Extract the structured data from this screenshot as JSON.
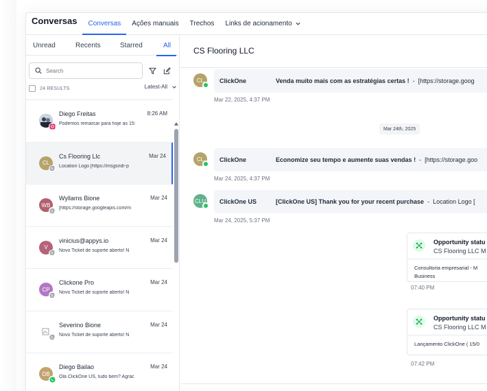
{
  "app": {
    "title": "Conversas"
  },
  "nav": {
    "tabs": [
      {
        "label": "Conversas"
      },
      {
        "label": "Ações manuais"
      },
      {
        "label": "Trechos"
      },
      {
        "label": "Links de acionamento"
      }
    ]
  },
  "filters": {
    "tabs": [
      {
        "label": "Unread"
      },
      {
        "label": "Recents"
      },
      {
        "label": "Starred"
      },
      {
        "label": "All"
      }
    ],
    "active": "All"
  },
  "search": {
    "placeholder": "Search",
    "results": "24 RESULTS",
    "sort": "Latest-All"
  },
  "conversations": [
    {
      "name": "Diego Freitas",
      "time": "8:26 AM",
      "preview": "Podemos remarcar para hoje as 15:",
      "initials": "",
      "channel": "instagram"
    },
    {
      "name": "Cs Flooring Llc",
      "time": "Mar 24",
      "preview": "Location Logo [https://msgsndr-p",
      "initials": "CL",
      "channel": "email"
    },
    {
      "name": "Wyllams Bione",
      "time": "Mar 24",
      "preview": "[https://storage.googleapis.com/m",
      "initials": "WB",
      "channel": "email"
    },
    {
      "name": "vinicius@appys.io",
      "time": "Mar 24",
      "preview": "Novo Ticket de suporte aberto! N",
      "initials": "V",
      "channel": "email"
    },
    {
      "name": "Clickone Pro",
      "time": "Mar 24",
      "preview": "Novo Ticket de suporte aberto! N",
      "initials": "CP",
      "channel": "email"
    },
    {
      "name": "Severino Bione",
      "time": "Mar 24",
      "preview": "Novo Ticket de suporte aberto! N",
      "initials": "",
      "channel": "email"
    },
    {
      "name": "Diego Bailao",
      "time": "Mar 24",
      "preview": "Olá ClickOne US, tudo bem? Agrac",
      "initials": "DB",
      "channel": "whatsapp"
    }
  ],
  "chat": {
    "title": "CS Flooring LLC",
    "date_divider": "Mar 24th, 2025",
    "messages": [
      {
        "initials": "CL",
        "sender": "ClickOne",
        "subject": "Venda muito mais com as estratégias certas !",
        "snippet": "[https://storage.goog",
        "time": "Mar 22, 2025, 4:37 PM"
      },
      {
        "initials": "CL",
        "sender": "ClickOne",
        "subject": "Economize seu tempo e aumente suas vendas !",
        "snippet": "[https://storage.goo",
        "time": "Mar 24, 2025, 4:37 PM"
      },
      {
        "initials": "CLU",
        "sender": "ClickOne US",
        "subject": "[ClickOne US] Thank you for your recent purchase",
        "snippet": "Location Logo [",
        "time": "Mar 24, 2025, 5:37 PM"
      }
    ],
    "cards": [
      {
        "title": "Opportunity statu",
        "subtitle": "CS Flooring LLC M",
        "body": "Consultoria empresarial - M Business",
        "time": "07:40 PM"
      },
      {
        "title": "Opportunity statu",
        "subtitle": "CS Flooring LLC M",
        "body": "Lançamento ClickOne ( 15/0",
        "time": "07:42 PM"
      }
    ]
  },
  "colors": {
    "accent": "#2563eb",
    "avatar_cl": "#b5a36a",
    "avatar_clu": "#5fb38a",
    "avatar_wb": "#b2606f",
    "avatar_v": "#b4637a",
    "avatar_cp": "#b377c4",
    "avatar_db": "#c2a36f"
  }
}
